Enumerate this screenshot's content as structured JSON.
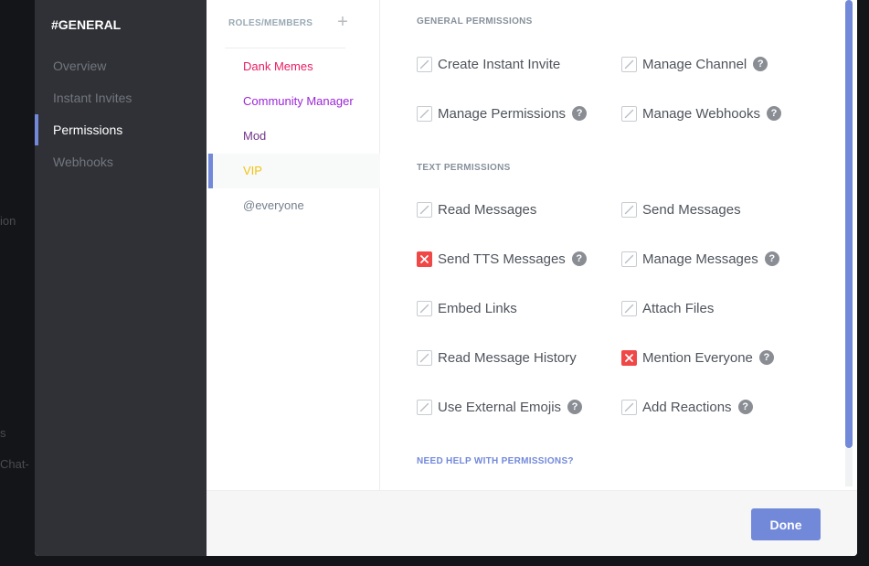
{
  "background_fragments": [
    "ion",
    "s",
    "Chat-"
  ],
  "sidebar": {
    "title": "#GENERAL",
    "items": [
      {
        "label": "Overview",
        "active": false
      },
      {
        "label": "Instant Invites",
        "active": false
      },
      {
        "label": "Permissions",
        "active": true
      },
      {
        "label": "Webhooks",
        "active": false
      }
    ]
  },
  "roles": {
    "header": "ROLES/MEMBERS",
    "add_icon": "+",
    "items": [
      {
        "label": "Dank Memes",
        "color": "#e91e63"
      },
      {
        "label": "Community Manager",
        "color": "#9b27d6"
      },
      {
        "label": "Mod",
        "color": "#71368a"
      },
      {
        "label": "VIP",
        "color": "#f1c40f"
      },
      {
        "label": "@everyone",
        "color": "#747f8d"
      }
    ],
    "selected": "VIP"
  },
  "permissions": {
    "general_header": "GENERAL PERMISSIONS",
    "general": [
      {
        "label": "Create Instant Invite",
        "state": "neutral",
        "help": false
      },
      {
        "label": "Manage Channel",
        "state": "neutral",
        "help": true
      },
      {
        "label": "Manage Permissions",
        "state": "neutral",
        "help": true
      },
      {
        "label": "Manage Webhooks",
        "state": "neutral",
        "help": true
      }
    ],
    "text_header": "TEXT PERMISSIONS",
    "text": [
      {
        "label": "Read Messages",
        "state": "neutral",
        "help": false
      },
      {
        "label": "Send Messages",
        "state": "neutral",
        "help": false
      },
      {
        "label": "Send TTS Messages",
        "state": "denied",
        "help": true
      },
      {
        "label": "Manage Messages",
        "state": "neutral",
        "help": true
      },
      {
        "label": "Embed Links",
        "state": "neutral",
        "help": false
      },
      {
        "label": "Attach Files",
        "state": "neutral",
        "help": false
      },
      {
        "label": "Read Message History",
        "state": "neutral",
        "help": false
      },
      {
        "label": "Mention Everyone",
        "state": "denied",
        "help": true
      },
      {
        "label": "Use External Emojis",
        "state": "neutral",
        "help": true
      },
      {
        "label": "Add Reactions",
        "state": "neutral",
        "help": true
      }
    ],
    "help_link": "NEED HELP WITH PERMISSIONS?",
    "help_glyph": "?"
  },
  "footer": {
    "done_label": "Done"
  },
  "colors": {
    "accent": "#7289da",
    "denied": "#f04747",
    "sidebar_bg": "#2f3136"
  }
}
